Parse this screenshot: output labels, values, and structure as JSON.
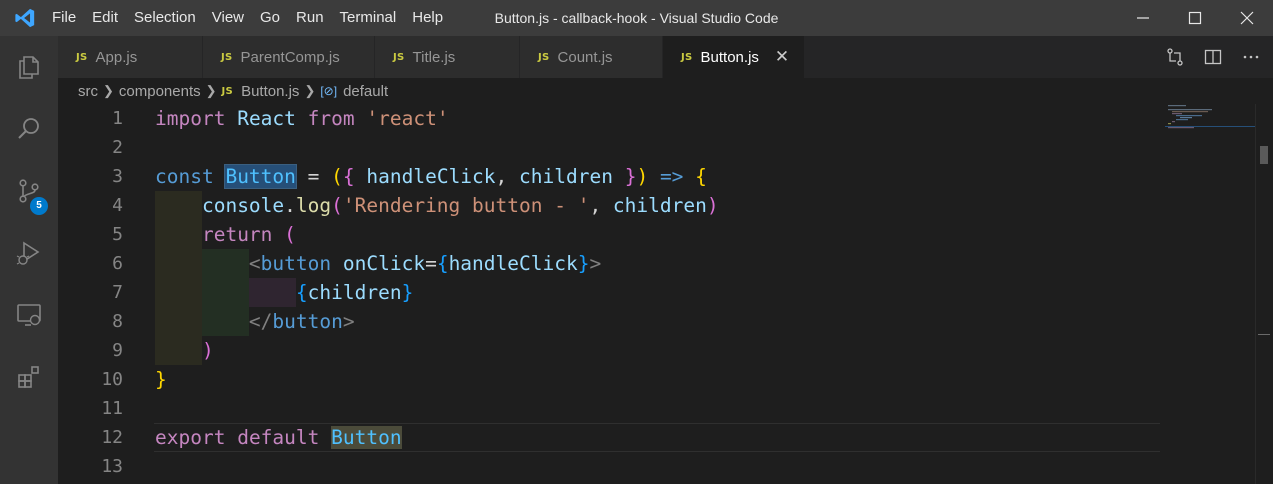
{
  "window_title": "Button.js - callback-hook - Visual Studio Code",
  "menu": [
    "File",
    "Edit",
    "Selection",
    "View",
    "Go",
    "Run",
    "Terminal",
    "Help"
  ],
  "tabs": [
    {
      "label": "App.js",
      "badge": "JS"
    },
    {
      "label": "ParentComp.js",
      "badge": "JS"
    },
    {
      "label": "Title.js",
      "badge": "JS"
    },
    {
      "label": "Count.js",
      "badge": "JS"
    },
    {
      "label": "Button.js",
      "badge": "JS",
      "active": true
    }
  ],
  "breadcrumb": {
    "folder1": "src",
    "folder2": "components",
    "file_badge": "JS",
    "file": "Button.js",
    "symbol": "default"
  },
  "scm_badge": "5",
  "line_numbers": [
    "1",
    "2",
    "3",
    "4",
    "5",
    "6",
    "7",
    "8",
    "9",
    "10",
    "11",
    "12",
    "13"
  ],
  "icons": {
    "activity": [
      "explorer-icon",
      "search-icon",
      "source-control-icon",
      "run-debug-icon",
      "remote-explorer-icon",
      "extensions-icon"
    ],
    "tab_actions": [
      "compare-changes-icon",
      "split-editor-icon",
      "more-actions-icon"
    ]
  },
  "colors": {
    "accent": "#007acc",
    "titlebar": "#3c3c3c",
    "activitybar": "#333333",
    "editor_bg": "#1e1e1e"
  }
}
